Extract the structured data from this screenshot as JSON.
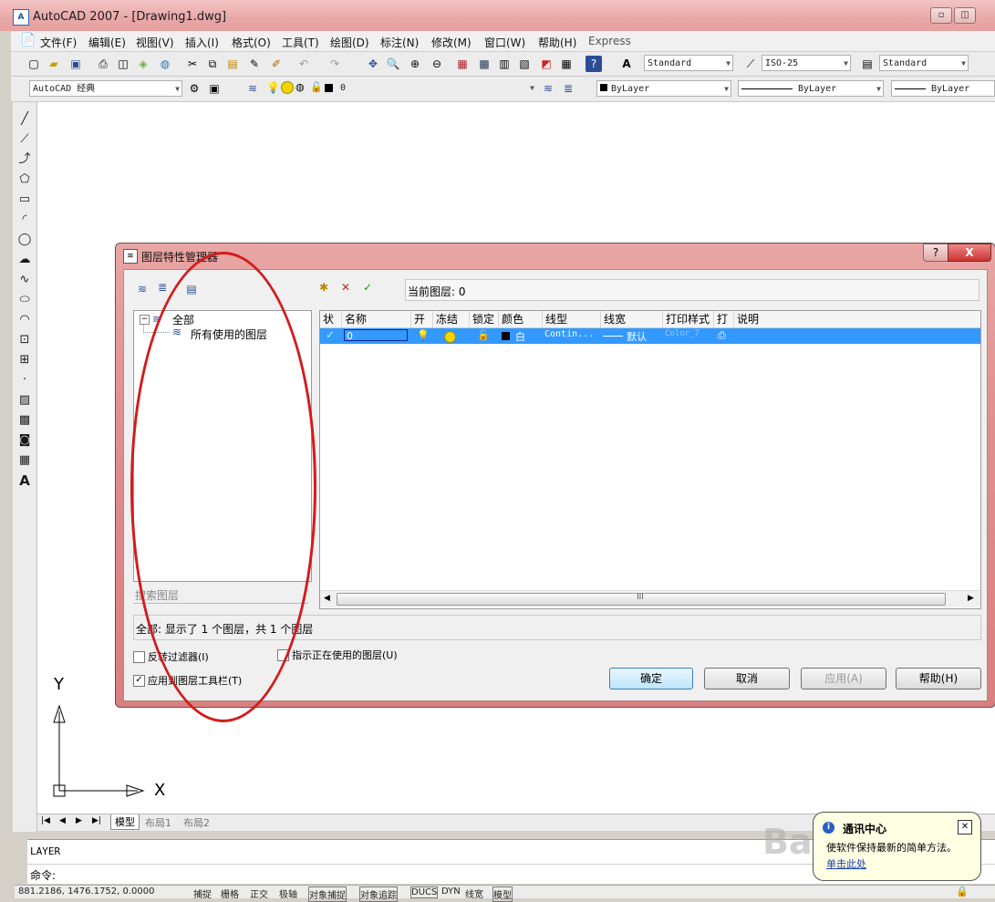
{
  "window": {
    "title": "AutoCAD 2007 - [Drawing1.dwg]",
    "icon": "autocad-icon",
    "minimize": "▫",
    "restore": "◫"
  },
  "menu": [
    "文件(F)",
    "编辑(E)",
    "视图(V)",
    "插入(I)",
    "格式(O)",
    "工具(T)",
    "绘图(D)",
    "标注(N)",
    "修改(M)",
    "窗口(W)",
    "帮助(H)",
    "Express"
  ],
  "toolbar1": {
    "text_style": "Standard",
    "dim_style": "ISO-25",
    "table_style": "Standard"
  },
  "toolbar2": {
    "workspace": "AutoCAD 经典",
    "layer_value": "0",
    "color": "ByLayer",
    "linetype": "ByLayer",
    "lineweight": "ByLayer"
  },
  "ucs": {
    "y": "Y",
    "x": "X"
  },
  "tabs": [
    "模型",
    "布局1",
    "布局2"
  ],
  "command": {
    "line1": "LAYER",
    "prompt": "命令:"
  },
  "status": {
    "coords": "881.2186, 1476.1752, 0.0000",
    "buttons": [
      "捕捉",
      "栅格",
      "正交",
      "极轴",
      "对象捕捉",
      "对象追踪",
      "DUCS",
      "DYN",
      "线宽",
      "模型"
    ]
  },
  "dialog": {
    "title": "图层特性管理器",
    "help": "?",
    "close": "X",
    "current_layer_label": "当前图层: 0",
    "tree": {
      "root": "全部",
      "child": "所有使用的图层"
    },
    "search_placeholder": "搜索图层",
    "columns": [
      "状",
      "名称",
      "开",
      "冻结",
      "锁定",
      "颜色",
      "线型",
      "线宽",
      "打印样式",
      "打",
      "说明"
    ],
    "row": {
      "name": "0",
      "color": "白",
      "linetype": "Contin...",
      "lineweight": "默认",
      "plotstyle": "Color_7"
    },
    "scroll_mark": "III",
    "summary": "全部: 显示了 1 个图层，共 1 个图层",
    "invert_filter": "反转过滤器(I)",
    "indicate_used": "指示正在使用的图层(U)",
    "apply_toolbar": "应用到图层工具栏(T)",
    "buttons": {
      "ok": "确定",
      "cancel": "取消",
      "apply": "应用(A)",
      "help": "帮助(H)"
    }
  },
  "popup": {
    "title": "通讯中心",
    "text": "使软件保持最新的简单方法。",
    "link": "单击此处"
  },
  "watermark": "Baidu经验",
  "colors": {
    "titlebar": "#e9a8a8",
    "selection": "#3399ff",
    "annotation": "#d21c1c"
  }
}
